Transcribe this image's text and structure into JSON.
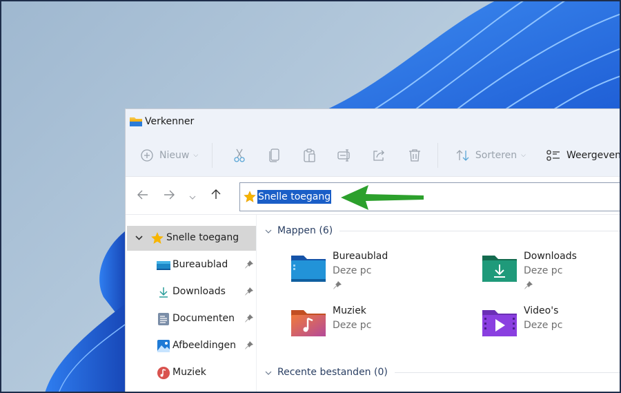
{
  "window": {
    "title": "Verkenner",
    "icon": "folder-icon"
  },
  "toolbar": {
    "new_label": "Nieuw",
    "sort_label": "Sorteren",
    "view_label": "Weergeven",
    "icons": [
      "cut-icon",
      "copy-icon",
      "paste-icon",
      "rename-icon",
      "share-icon",
      "delete-icon"
    ]
  },
  "navigation": {
    "back": "back-arrow-icon",
    "forward": "forward-arrow-icon",
    "recent": "chevron-down-icon",
    "up": "up-arrow-icon"
  },
  "address_bar": {
    "value": "Snelle toegang",
    "icon": "star-icon",
    "selected": true
  },
  "annotation": {
    "arrow_color": "#2ca02c"
  },
  "sidebar": {
    "root": {
      "label": "Snelle toegang",
      "icon": "star-icon",
      "expanded": true
    },
    "items": [
      {
        "label": "Bureaublad",
        "icon": "desktop-icon",
        "pinned": true
      },
      {
        "label": "Downloads",
        "icon": "download-icon",
        "pinned": true
      },
      {
        "label": "Documenten",
        "icon": "document-icon",
        "pinned": true
      },
      {
        "label": "Afbeeldingen",
        "icon": "pictures-icon",
        "pinned": true
      },
      {
        "label": "Muziek",
        "icon": "music-icon",
        "pinned": false
      }
    ]
  },
  "content": {
    "folders_header": "Mappen (6)",
    "folders": [
      {
        "name": "Bureaublad",
        "location": "Deze pc",
        "pinned": true,
        "icon": "desktop-folder-icon"
      },
      {
        "name": "Downloads",
        "location": "Deze pc",
        "pinned": true,
        "icon": "downloads-folder-icon"
      },
      {
        "name": "Muziek",
        "location": "Deze pc",
        "pinned": false,
        "icon": "music-folder-icon"
      },
      {
        "name": "Video's",
        "location": "Deze pc",
        "pinned": false,
        "icon": "videos-folder-icon"
      }
    ],
    "recent_header": "Recente bestanden (0)"
  },
  "colors": {
    "selection": "#1a5ec7",
    "sidebar_active": "#d6d6d6",
    "arrow": "#2ca02c"
  }
}
